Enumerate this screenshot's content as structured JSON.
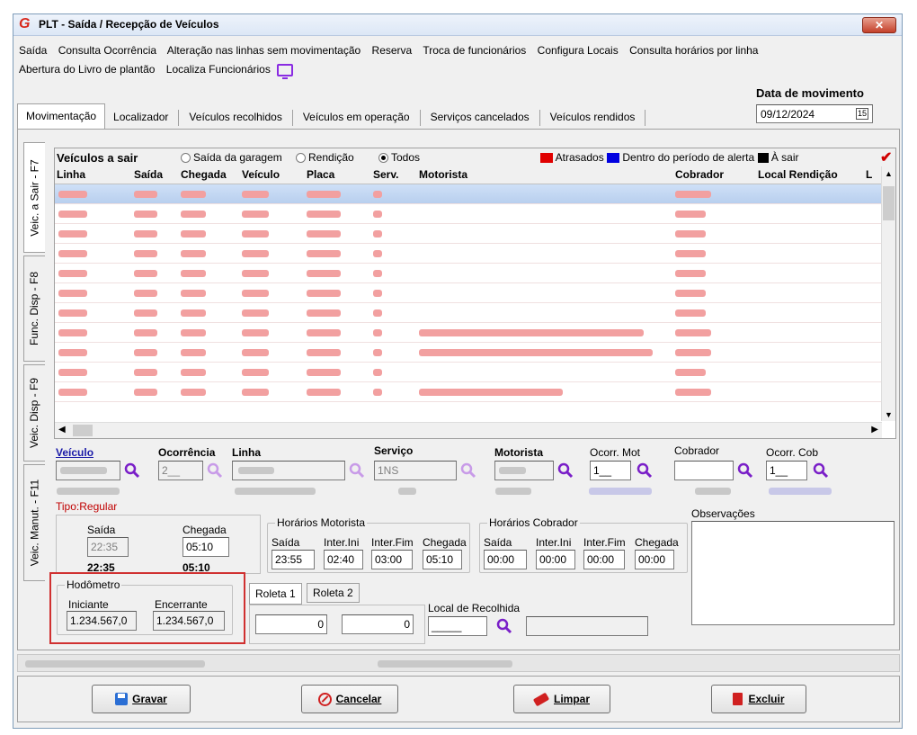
{
  "window": {
    "title": "PLT - Saída / Recepção de Veículos",
    "close_icon": "close-icon"
  },
  "menu": {
    "row1": [
      "Saída",
      "Consulta Ocorrência",
      "Alteração nas linhas sem movimentação",
      "Reserva",
      "Troca de funcionários",
      "Configura Locais",
      "Consulta horários por linha"
    ],
    "row2": [
      "Abertura do Livro de plantão",
      "Localiza Funcionários"
    ]
  },
  "tabs": [
    "Movimentação",
    "Localizador",
    "Veículos recolhidos",
    "Veículos em operação",
    "Serviços cancelados",
    "Veículos rendidos"
  ],
  "date": {
    "label": "Data de movimento",
    "value": "09/12/2024"
  },
  "side_tabs": [
    "Veic. a Sair - F7",
    "Func. Disp - F8",
    "Veic. Disp - F9",
    "Veic. Manut. - F11"
  ],
  "grid": {
    "title": "Veículos a sair",
    "filters": [
      "Saída da garagem",
      "Rendição",
      "Todos"
    ],
    "legend": [
      "Atrasados",
      "Dentro do período de alerta",
      "À sair"
    ],
    "columns": [
      "Linha",
      "Saída",
      "Chegada",
      "Veículo",
      "Placa",
      "Serv.",
      "Motorista",
      "Cobrador",
      "Local Rendição",
      "L"
    ],
    "colors": {
      "late": "#e00000",
      "alert": "#0000e0",
      "to_leave": "#000000",
      "blurred": "#f2a0a0"
    }
  },
  "form": {
    "veiculo_label": "Veículo",
    "ocorrencia_label": "Ocorrência",
    "linha_label": "Linha",
    "ocorrencia_value": "2__",
    "servico_label": "Serviço",
    "servico_value": "1NS",
    "motorista_label": "Motorista",
    "ocorr_mot_label": "Ocorr. Mot",
    "ocorr_mot_value": "1__",
    "cobrador_label": "Cobrador",
    "ocorr_cob_label": "Ocorr. Cob",
    "ocorr_cob_value": "1__",
    "tipo": "Tipo:Regular",
    "saida_label": "Saída",
    "saida_value": "22:35",
    "saida_bold": "22:35",
    "chegada_label": "Chegada",
    "chegada_value": "05:10",
    "chegada_bold": "05:10",
    "horarios_motorista": {
      "title": "Horários Motorista",
      "labels": [
        "Saída",
        "Inter.Ini",
        "Inter.Fim",
        "Chegada"
      ],
      "values": [
        "23:55",
        "02:40",
        "03:00",
        "05:10"
      ]
    },
    "horarios_cobrador": {
      "title": "Horários Cobrador",
      "labels": [
        "Saída",
        "Inter.Ini",
        "Inter.Fim",
        "Chegada"
      ],
      "values": [
        "00:00",
        "00:00",
        "00:00",
        "00:00"
      ]
    },
    "observacoes_label": "Observações",
    "hodometro": {
      "title": "Hodômetro",
      "iniciante_label": "Iniciante",
      "iniciante_value": "1.234.567,0",
      "encerrante_label": "Encerrante",
      "encerrante_value": "1.234.567,0"
    },
    "roleta_tabs": [
      "Roleta 1",
      "Roleta 2"
    ],
    "roleta_values": [
      "0",
      "0"
    ],
    "local_recolhida_label": "Local de Recolhida",
    "local_recolhida_value": "_____"
  },
  "buttons": {
    "gravar": "Gravar",
    "cancelar": "Cancelar",
    "limpar": "Limpar",
    "excluir": "Excluir"
  }
}
